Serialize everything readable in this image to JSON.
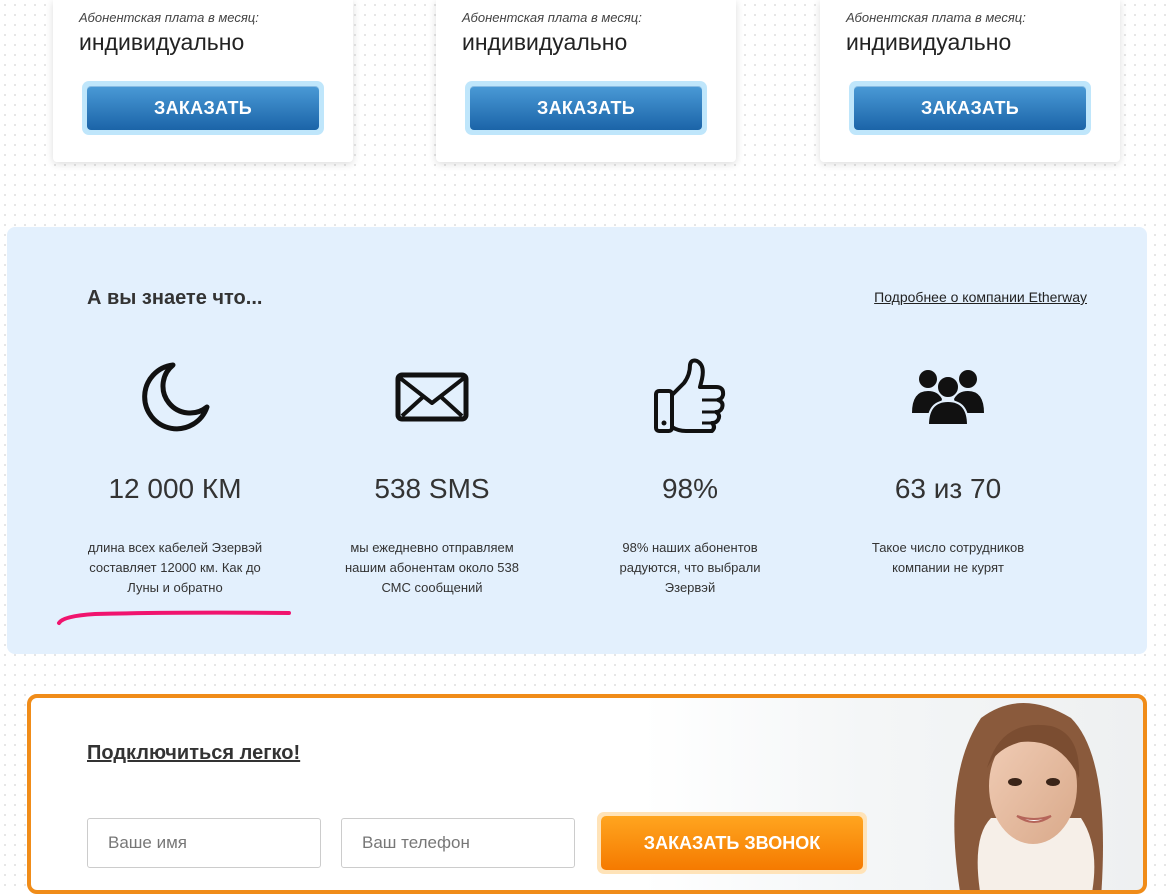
{
  "cards": [
    {
      "fee_label": "Абонентская плата в месяц:",
      "fee_value": "индивидуально",
      "button": "ЗАКАЗАТЬ"
    },
    {
      "fee_label": "Абонентская плата в месяц:",
      "fee_value": "индивидуально",
      "button": "ЗАКАЗАТЬ"
    },
    {
      "fee_label": "Абонентская плата в месяц:",
      "fee_value": "индивидуально",
      "button": "ЗАКАЗАТЬ"
    }
  ],
  "facts": {
    "title": "А вы знаете что...",
    "link": "Подробнее о компании Etherway",
    "items": [
      {
        "icon": "moon-icon",
        "value": "12 000 КМ",
        "desc": "длина всех кабелей Эзервэй составляет 12000 км. Как до Луны и обратно"
      },
      {
        "icon": "envelope-icon",
        "value": "538 SMS",
        "desc": "мы ежедневно отправляем нашим абонентам около 538 СМС сообщений"
      },
      {
        "icon": "thumbs-up-icon",
        "value": "98%",
        "desc": "98% наших абонентов радуются, что выбрали Эзервэй"
      },
      {
        "icon": "users-icon",
        "value": "63 из 70",
        "desc": "Такое число сотрудников компании не курят"
      }
    ],
    "highlight_color": "#f0146e"
  },
  "connect": {
    "title": "Подключиться легко!",
    "name_placeholder": "Ваше имя",
    "phone_placeholder": "Ваш телефон",
    "button": "ЗАКАЗАТЬ ЗВОНОК"
  },
  "colors": {
    "accent_blue": "#1b64a8",
    "accent_orange": "#f57a00",
    "facts_bg": "#e3f0fd"
  }
}
